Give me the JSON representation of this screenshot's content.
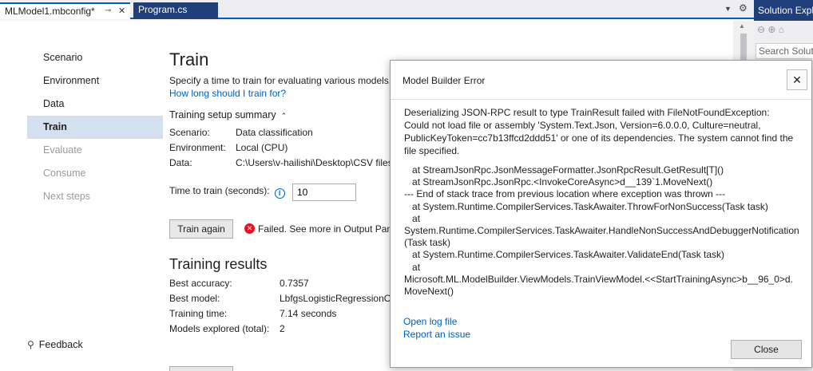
{
  "tabs": {
    "active_label": "MLModel1.mbconfig*",
    "pin_glyph": "⊸",
    "close_glyph": "✕",
    "inactive_label": "Program.cs",
    "menu_glyph": "▼",
    "gear_glyph": "⚙"
  },
  "solution_explorer": {
    "title": "Solution Explorer",
    "toolbar": "⊖ ⊕ ⌂",
    "search_placeholder": "Search Solution Explorer"
  },
  "nav": {
    "items": [
      {
        "label": "Scenario",
        "state": "normal"
      },
      {
        "label": "Environment",
        "state": "normal"
      },
      {
        "label": "Data",
        "state": "normal"
      },
      {
        "label": "Train",
        "state": "active"
      },
      {
        "label": "Evaluate",
        "state": "disabled"
      },
      {
        "label": "Consume",
        "state": "disabled"
      },
      {
        "label": "Next steps",
        "state": "disabled"
      }
    ],
    "feedback_label": "Feedback",
    "feedback_icon": "⚲"
  },
  "train": {
    "title": "Train",
    "description": "Specify a time to train for evaluating various models. Lo",
    "link": "How long should I train for?",
    "setup_summary_label": "Training setup summary",
    "setup_chevron": "⌃",
    "scenario_label": "Scenario:",
    "scenario_value": "Data classification",
    "environment_label": "Environment:",
    "environment_value": "Local (CPU)",
    "data_label": "Data:",
    "data_value": "C:\\Users\\v-hailishi\\Desktop\\CSV files",
    "time_label": "Time to train (seconds):",
    "info_glyph": "i",
    "time_value": "10",
    "train_again_button": "Train again",
    "error_glyph": "✕",
    "error_text": "Failed. See more in Output Pane"
  },
  "results": {
    "title": "Training results",
    "best_accuracy_label": "Best accuracy:",
    "best_accuracy_value": "0.7357",
    "best_model_label": "Best model:",
    "best_model_value": "LbfgsLogisticRegressionOv",
    "training_time_label": "Training time:",
    "training_time_value": "7.14 seconds",
    "models_explored_label": "Models explored (total):",
    "models_explored_value": "2"
  },
  "dialog": {
    "title": "Model Builder Error",
    "close_glyph": "✕",
    "message": "Deserializing JSON-RPC result to type TrainResult failed with FileNotFoundException: Could not load file or assembly 'System.Text.Json, Version=6.0.0.0, Culture=neutral, PublicKeyToken=cc7b13ffcd2ddd51' or one of its dependencies. The system cannot find the file specified.",
    "stack_trace": "   at StreamJsonRpc.JsonMessageFormatter.JsonRpcResult.GetResult[T]()\n   at StreamJsonRpc.JsonRpc.<InvokeCoreAsync>d__139`1.MoveNext()\n--- End of stack trace from previous location where exception was thrown ---\n   at System.Runtime.CompilerServices.TaskAwaiter.ThrowForNonSuccess(Task task)\n   at\nSystem.Runtime.CompilerServices.TaskAwaiter.HandleNonSuccessAndDebuggerNotification(Task task)\n   at System.Runtime.CompilerServices.TaskAwaiter.ValidateEnd(Task task)\n   at\nMicrosoft.ML.ModelBuilder.ViewModels.TrainViewModel.<<StartTrainingAsync>b__96_0>d.MoveNext()",
    "open_log_link": "Open log file",
    "report_issue_link": "Report an issue",
    "close_button": "Close"
  }
}
